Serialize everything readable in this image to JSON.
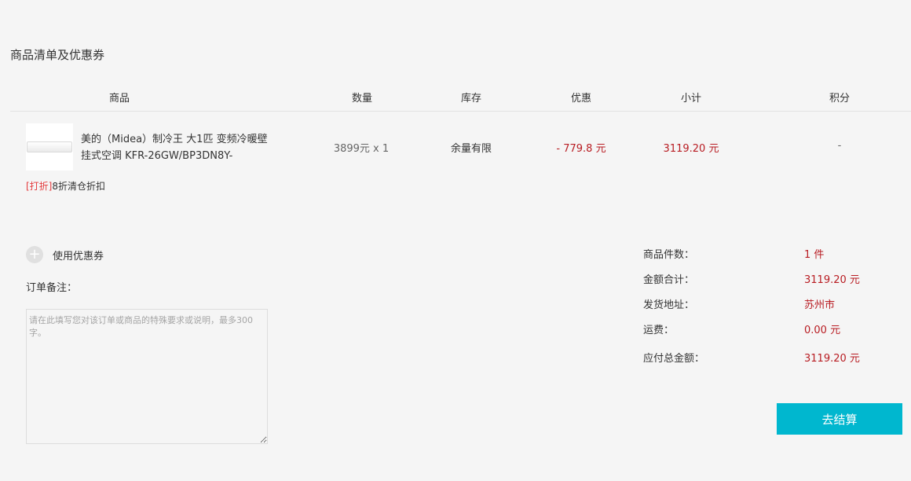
{
  "section": {
    "title": "商品清单及优惠券"
  },
  "table": {
    "headers": [
      "商品",
      "数量",
      "库存",
      "优惠",
      "小计",
      "积分"
    ],
    "row": {
      "name": "美的（Midea）制冷王 大1匹 变频冷暖壁挂式空调 KFR-26GW/BP3DN8Y-",
      "quantity": "3899元 x 1",
      "stock": "余量有限",
      "discount": "- 779.8 元",
      "subtotal": "3119.20 元",
      "points": "-"
    },
    "promotion": {
      "tag": "[打折]",
      "text": "8折清仓折扣"
    }
  },
  "coupon": {
    "label": "使用优惠券"
  },
  "remark": {
    "label": "订单备注：",
    "placeholder": "请在此填写您对该订单或商品的特殊要求或说明，最多300字。"
  },
  "summary": {
    "items": [
      {
        "label": "商品件数：",
        "value": "1 件"
      },
      {
        "label": "金额合计：",
        "value": "3119.20 元"
      },
      {
        "label": "发货地址：",
        "value": "苏州市"
      },
      {
        "label": "运费：",
        "value": "0.00 元"
      },
      {
        "label": "应付总金额：",
        "value": "3119.20 元"
      }
    ]
  },
  "checkout": {
    "label": "去结算"
  },
  "colors": {
    "accent": "#00b7cf",
    "price": "#b81c22",
    "promo_tag": "#e4393c"
  }
}
